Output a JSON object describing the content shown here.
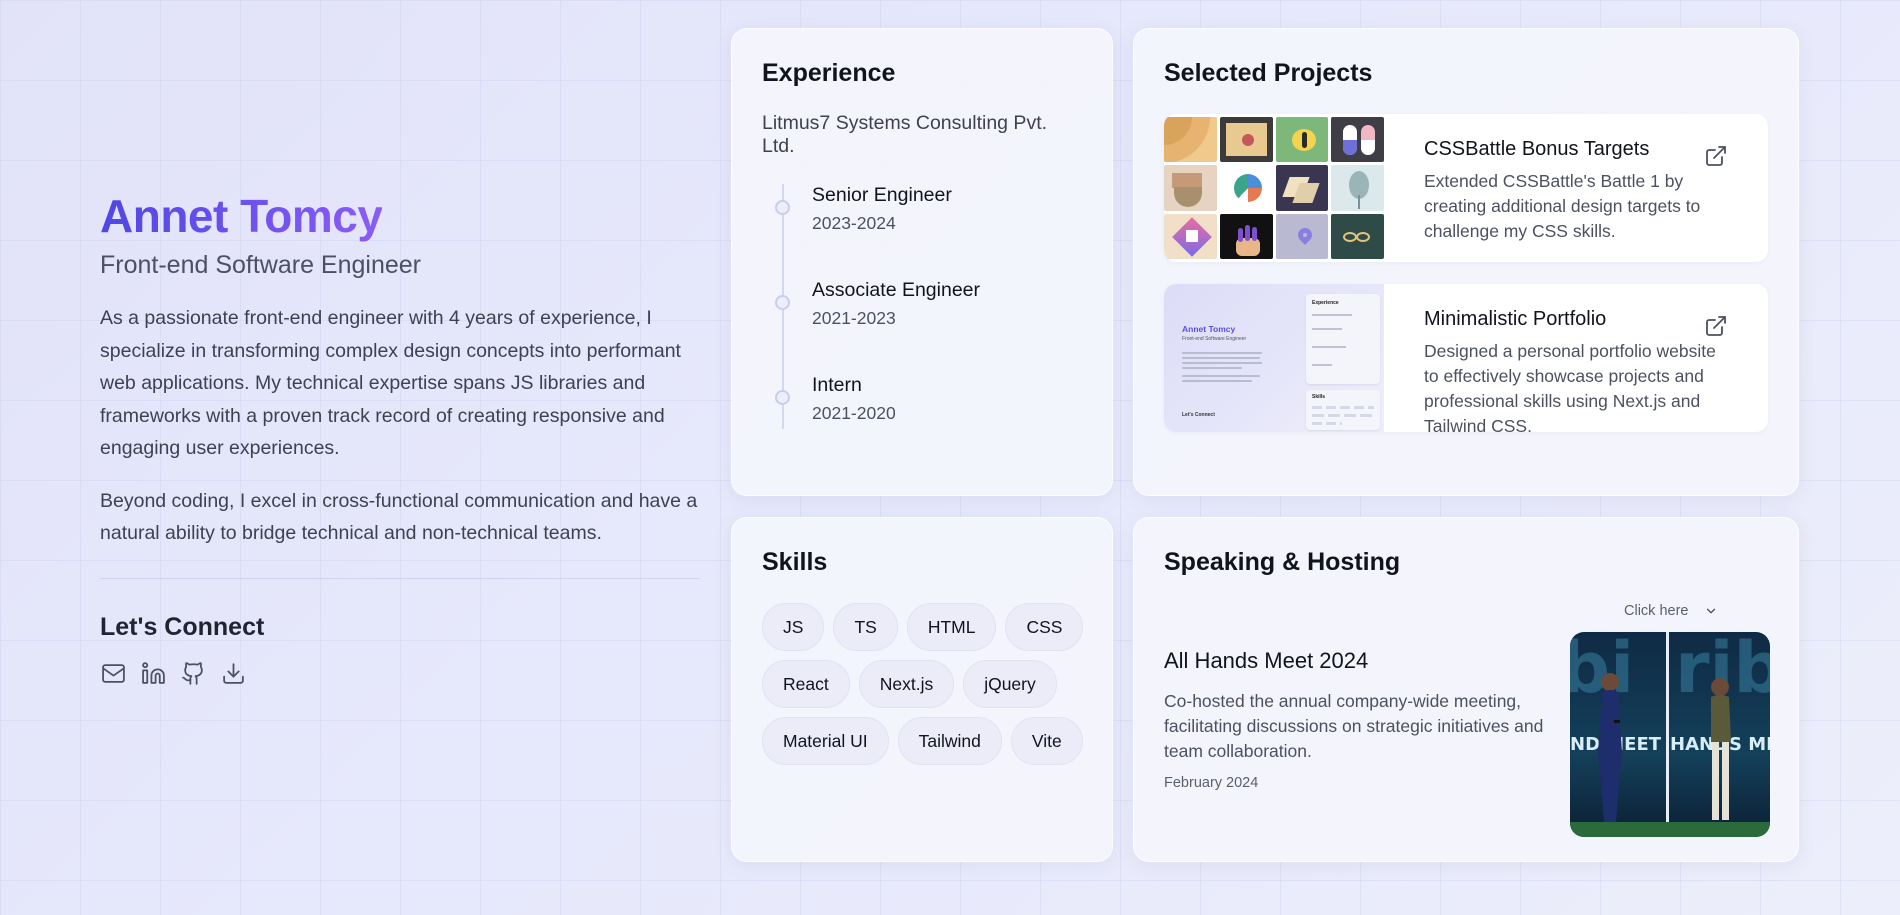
{
  "profile": {
    "name": "Annet Tomcy",
    "role": "Front-end Software Engineer",
    "bio": [
      "As a passionate front-end engineer with 4 years of experience, I specialize in transforming complex design concepts into performant web applications. My technical expertise spans JS libraries and frameworks with a proven track record of creating responsive and engaging user experiences.",
      "Beyond coding, I excel in cross-functional communication and have a natural ability to bridge technical and non-technical teams."
    ],
    "connect_title": "Let's Connect",
    "socials": [
      {
        "icon": "mail-icon"
      },
      {
        "icon": "linkedin-icon"
      },
      {
        "icon": "github-icon"
      },
      {
        "icon": "download-icon"
      }
    ]
  },
  "experience": {
    "title": "Experience",
    "company": "Litmus7 Systems Consulting Pvt. Ltd.",
    "roles": [
      {
        "title": "Senior Engineer",
        "years": "2023-2024"
      },
      {
        "title": "Associate Engineer",
        "years": "2021-2023"
      },
      {
        "title": "Intern",
        "years": "2021-2020"
      }
    ]
  },
  "projects": {
    "title": "Selected Projects",
    "items": [
      {
        "title": "CSSBattle Bonus Targets",
        "description": "Extended CSSBattle's Battle 1 by creating additional design targets to challenge my CSS skills.",
        "link_icon": "external-link-icon"
      },
      {
        "title": "Minimalistic Portfolio",
        "description": "Designed a personal portfolio website to effectively showcase projects and professional skills using Next.js and Tailwind CSS.",
        "link_icon": "external-link-icon"
      }
    ],
    "mini_preview": {
      "name": "Annet Tomcy",
      "role": "Front-end Software Engineer",
      "connect": "Let's Connect",
      "exp_title": "Experience",
      "skills_title": "Skills"
    }
  },
  "skills": {
    "title": "Skills",
    "items": [
      "JS",
      "TS",
      "HTML",
      "CSS",
      "React",
      "Next.js",
      "jQuery",
      "Material UI",
      "Tailwind",
      "Vite"
    ]
  },
  "speaking": {
    "title": "Speaking & Hosting",
    "click_here": "Click here",
    "event_title": "All Hands Meet 2024",
    "event_description": "Co-hosted the annual company-wide meeting, facilitating discussions on strategic initiatives and team collaboration.",
    "event_date": "February 2024",
    "photo_text_left": "ND MEET",
    "photo_text_right": "HANDS ME"
  },
  "colors": {
    "accent_start": "#4f46e5",
    "accent_end": "#8b5cf6",
    "background": "#e4e5fa"
  }
}
